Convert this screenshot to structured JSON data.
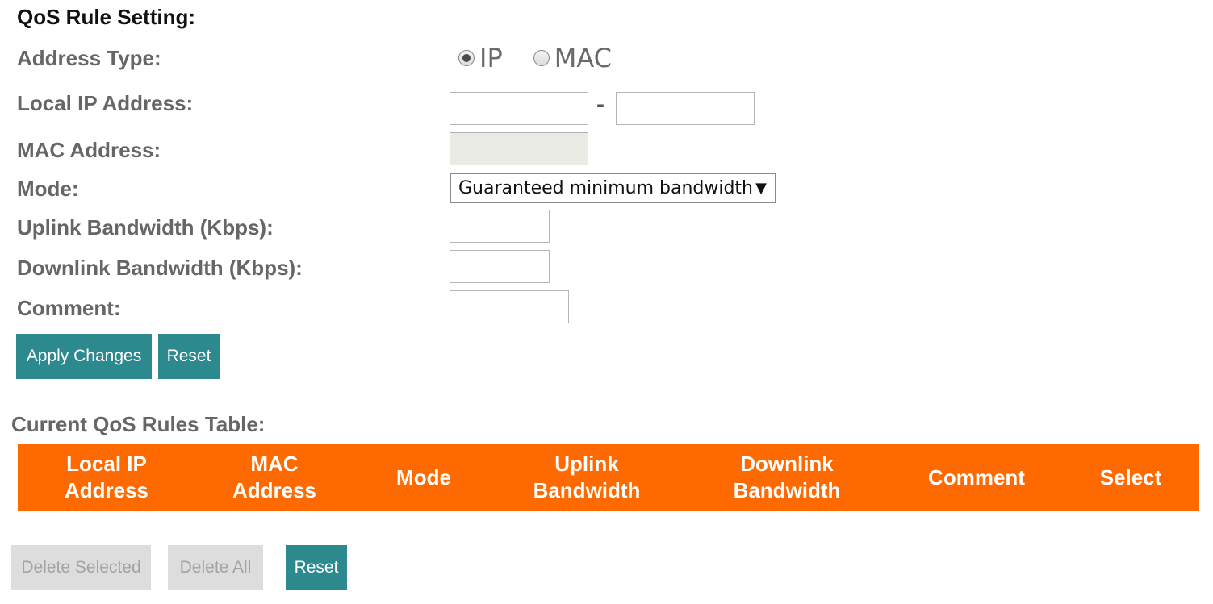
{
  "form": {
    "section_title": "QoS Rule Setting:",
    "address_type_label": "Address Type:",
    "address_type_options": {
      "ip": "IP",
      "mac": "MAC",
      "selected": "IP"
    },
    "local_ip_label": "Local IP Address:",
    "local_ip_start_value": "",
    "local_ip_separator": "-",
    "local_ip_end_value": "",
    "mac_label": "MAC Address:",
    "mac_value": "",
    "mode_label": "Mode:",
    "mode_value": "Guaranteed minimum bandwidth",
    "uplink_label": "Uplink Bandwidth (Kbps):",
    "uplink_value": "",
    "downlink_label": "Downlink Bandwidth (Kbps):",
    "downlink_value": "",
    "comment_label": "Comment:",
    "comment_value": "",
    "apply_label": "Apply Changes",
    "reset_label": "Reset"
  },
  "table": {
    "title": "Current QoS Rules Table:",
    "columns": {
      "local_ip": [
        "Local IP",
        "Address"
      ],
      "mac": [
        "MAC",
        "Address"
      ],
      "mode": [
        "Mode"
      ],
      "uplink": [
        "Uplink",
        "Bandwidth"
      ],
      "downlink": [
        "Downlink",
        "Bandwidth"
      ],
      "comment": [
        "Comment"
      ],
      "select": [
        "Select"
      ]
    },
    "header_color": "#ff6a00",
    "rows": []
  },
  "actions": {
    "delete_selected_label": "Delete Selected",
    "delete_all_label": "Delete All",
    "reset_label": "Reset"
  },
  "colors": {
    "button_teal": "#2c8a8f",
    "button_disabled": "#dddddd"
  },
  "icons": {
    "select_arrow": "caret-down-icon"
  }
}
